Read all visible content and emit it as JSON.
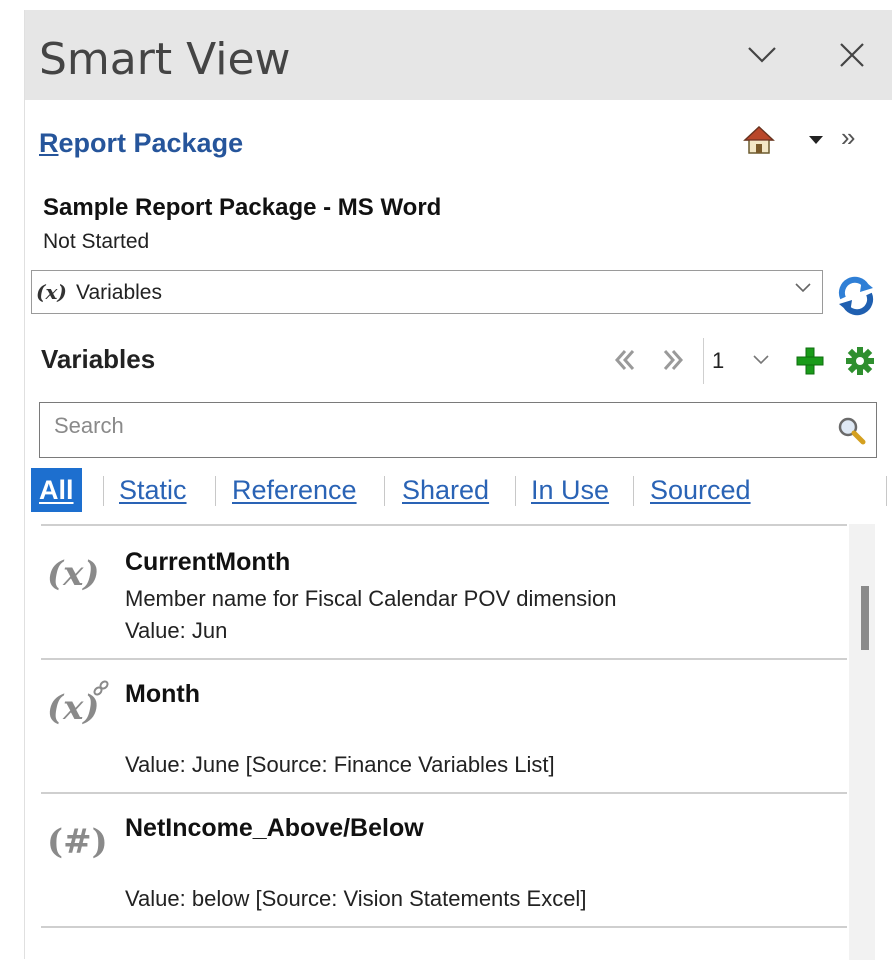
{
  "window": {
    "title": "Smart View"
  },
  "panel": {
    "link_first_letter": "R",
    "link_rest": "eport Package",
    "package_name": "Sample Report Package - MS Word",
    "status": "Not Started"
  },
  "selector": {
    "icon": "(x)",
    "value": "Variables"
  },
  "section": {
    "title": "Variables",
    "page": "1"
  },
  "search": {
    "placeholder": "Search"
  },
  "filters": {
    "all": "All",
    "static": "Static",
    "reference": "Reference",
    "shared": "Shared",
    "in_use": "In Use",
    "sourced": "Sourced"
  },
  "variables": [
    {
      "glyph": "(x)",
      "name": "CurrentMonth",
      "description": "Member name for Fiscal Calendar POV dimension",
      "value": "Value: Jun"
    },
    {
      "glyph": "(x)",
      "name": "Month",
      "description": "",
      "value": "Value: June [Source: Finance Variables List]"
    },
    {
      "glyph": "(#)",
      "name": "NetIncome_Above/Below",
      "description": "",
      "value": "Value: below [Source: Vision Statements Excel]"
    }
  ],
  "colors": {
    "accent": "#1d6fcf",
    "link": "#26559b",
    "titlebar": "#e6e6e6",
    "add_green": "#1a9b1a",
    "settings_green": "#2f8f2f"
  },
  "icons": [
    "chevron-down-icon",
    "close-icon",
    "home-icon",
    "dropdown-caret-icon",
    "double-chevron-right-icon",
    "refresh-icon",
    "previous-icon",
    "next-icon",
    "add-icon",
    "settings-icon",
    "search-icon"
  ]
}
